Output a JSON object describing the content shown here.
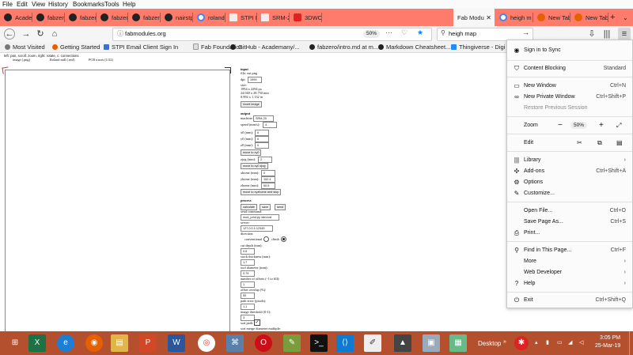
{
  "menubar": {
    "items": [
      "File",
      "Edit",
      "View",
      "History",
      "Bookmarks",
      "Tools",
      "Help"
    ]
  },
  "tabs": [
    {
      "label": "Academ",
      "icon": "github-icon"
    },
    {
      "label": "fabzero",
      "icon": "github-icon"
    },
    {
      "label": "fabzero",
      "icon": "github-icon"
    },
    {
      "label": "fabzero",
      "icon": "github-icon"
    },
    {
      "label": "fabzero",
      "icon": "github-icon"
    },
    {
      "label": "nairstpr",
      "icon": "github-icon"
    },
    {
      "label": "roland",
      "icon": "google-icon"
    },
    {
      "label": "STPI Em",
      "icon": "document-icon"
    },
    {
      "label": "SRM-20",
      "icon": "document-icon"
    },
    {
      "label": "3DWOX",
      "icon": "sindoh-icon"
    },
    {
      "label": "Fab Modu",
      "icon": "page-icon",
      "active": true
    },
    {
      "label": "heigh m",
      "icon": "google-icon"
    },
    {
      "label": "New Tab",
      "icon": "firefox-icon"
    },
    {
      "label": "New Tab",
      "icon": "firefox-icon"
    }
  ],
  "nav": {
    "url": "fabmodules.org",
    "zoom": "50%",
    "search": "heigh map"
  },
  "bookmarks": [
    {
      "label": "Most Visited",
      "icon": "gear-icon"
    },
    {
      "label": "Getting Started",
      "icon": "firefox-icon"
    },
    {
      "label": "STPI Email Client Sign In",
      "icon": "mail-icon"
    },
    {
      "label": "Fab Foundation",
      "icon": "page-icon"
    },
    {
      "label": "GitHub - Academany/...",
      "icon": "github-icon"
    },
    {
      "label": "fabzero/intro.md at m...",
      "icon": "github-icon"
    },
    {
      "label": "Markdown Cheatsheet...",
      "icon": "github-icon"
    },
    {
      "label": "Thingiverse - Digi",
      "icon": "thingiverse-icon"
    }
  ],
  "page": {
    "hint": "left: pan, scroll: zoom, right: rotate, c: connections",
    "pipeline": [
      "image (.png)",
      "Roland mill (.rml)",
      "PCB traces (1/32)"
    ],
    "input": {
      "heading": "input",
      "file": "file: out.png",
      "dpi_label": "dpi:",
      "dpi": "1999",
      "size_label": "size:",
      "size_px": "1994 x 2294 px",
      "size_mm": "24.040 x 28.750 mm",
      "size_in": "0.992 x 1.132 in",
      "invert": "invert image"
    },
    "output": {
      "heading": "output",
      "machine_label": "machine:",
      "machine": "SRM-20",
      "speed_label": "speed (mm/s):",
      "speed": "4",
      "x0_label": "x0 (mm):",
      "x0": "0",
      "y0_label": "y0 (mm):",
      "y0": "0",
      "z0_label": "z0 (mm):",
      "z0": "0",
      "move_xy0": "move to xy0",
      "zjog_label": "zjog (mm):",
      "zjog": "2",
      "move_zjog": "move to xy0 zjog",
      "xhome_label": "xhome (mm):",
      "xhome": "0",
      "yhome_label": "yhome (mm):",
      "yhome": "152.4",
      "zhome_label": "zhome (mm):",
      "zhome": "60.5",
      "move_home": "move to xyzhome and stop"
    },
    "process": {
      "heading": "process",
      "calculate": "calculate",
      "save": "save",
      "send": "send",
      "send_cmd_label": "send command:",
      "send_cmd": "mod_print.py /dev/ust",
      "server_label": "server:",
      "server": "127.0.0.1:12345",
      "direction_label": "direction:",
      "conventional": "conventional",
      "climb": "climb",
      "cut_depth_label": "cut depth (mm):",
      "cut_depth": "0.6",
      "stock_label": "stock thickness (mm):",
      "stock": "1.7",
      "tool_label": "tool diameter (mm):",
      "tool": "0.79",
      "offsets_label": "number of offsets (-1 to fill):",
      "offsets": "1",
      "overlap_label": "offset overlap (%):",
      "overlap": "50",
      "path_err_label": "path error (pixels):",
      "path_err": "1.1",
      "thresh_label": "image threshold (0-1):",
      "thresh": "3",
      "sort_label": "sort path:",
      "sort_merge_label": "sort merge diameter multiple:"
    }
  },
  "menu": {
    "sync": "Sign in to Sync",
    "blocking": "Content Blocking",
    "blocking_val": "Standard",
    "new_window": "New Window",
    "new_window_sc": "Ctrl+N",
    "private": "New Private Window",
    "private_sc": "Ctrl+Shift+P",
    "restore": "Restore Previous Session",
    "zoom": "Zoom",
    "zoom_minus": "−",
    "zoom_val": "50%",
    "zoom_plus": "+",
    "edit": "Edit",
    "library": "Library",
    "addons": "Add-ons",
    "addons_sc": "Ctrl+Shift+A",
    "options": "Options",
    "customize": "Customize...",
    "open": "Open File...",
    "open_sc": "Ctrl+O",
    "savepage": "Save Page As...",
    "savepage_sc": "Ctrl+S",
    "print": "Print...",
    "find": "Find in This Page...",
    "find_sc": "Ctrl+F",
    "more": "More",
    "webdev": "Web Developer",
    "help": "Help",
    "exit": "Exit",
    "exit_sc": "Ctrl+Shift+Q"
  },
  "taskbar": {
    "desktop": "Desktop",
    "time": "3:05 PM",
    "date": "25-Mar-19"
  },
  "colors": {
    "tabstrip": "#ff7b6b",
    "taskbar": "#b5502e",
    "accent": "#0a84ff"
  }
}
